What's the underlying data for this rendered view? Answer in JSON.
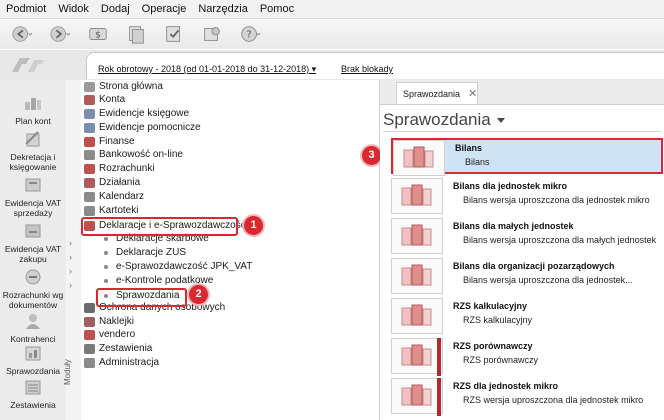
{
  "menu": [
    "Podmiot",
    "Widok",
    "Dodaj",
    "Operacje",
    "Narzędzia",
    "Pomoc"
  ],
  "toolbar_icons": [
    "back-icon",
    "forward-icon",
    "money-icon",
    "documents-icon",
    "check-doc-icon",
    "stamp-icon",
    "help-icon"
  ],
  "header": {
    "year_label": "Rok obrotowy - 2018  (od 01-01-2018 do 31-12-2018)",
    "locks_label": "Brak blokady"
  },
  "leftnav": [
    {
      "label": "Plan kont",
      "icon": "chart-of-accounts-icon"
    },
    {
      "label": "Dekretacja i księgowanie",
      "icon": "posting-icon"
    },
    {
      "label": "Ewidencja VAT sprzedaży",
      "icon": "vat-sales-icon"
    },
    {
      "label": "Ewidencja VAT zakupu",
      "icon": "vat-purchase-icon"
    },
    {
      "label": "Rozrachunki wg dokumentów",
      "icon": "settlements-icon"
    },
    {
      "label": "Kontrahenci",
      "icon": "contractors-icon"
    },
    {
      "label": "Sprawozdania",
      "icon": "reports-icon"
    },
    {
      "label": "Zestawienia",
      "icon": "statements-icon"
    }
  ],
  "vertical_label": "Moduły",
  "tree": [
    {
      "label": "Strona główna",
      "type": "icon"
    },
    {
      "label": "Konta",
      "type": "icon"
    },
    {
      "label": "Ewidencje księgowe",
      "type": "icon"
    },
    {
      "label": "Ewidencje pomocnicze",
      "type": "icon"
    },
    {
      "label": "Finanse",
      "type": "icon"
    },
    {
      "label": "Bankowość on-line",
      "type": "icon"
    },
    {
      "label": "Rozrachunki",
      "type": "icon"
    },
    {
      "label": "Działania",
      "type": "icon"
    },
    {
      "label": "Kalendarz",
      "type": "icon"
    },
    {
      "label": "Kartoteki",
      "type": "icon"
    },
    {
      "label": "Deklaracje i e-Sprawozdawczość",
      "type": "icon"
    },
    {
      "label": "Deklaracje skarbowe",
      "type": "bullet"
    },
    {
      "label": "Deklaracje ZUS",
      "type": "bullet"
    },
    {
      "label": "e-Sprawozdawczość JPK_VAT",
      "type": "bullet"
    },
    {
      "label": "e-Kontrole podatkowe",
      "type": "bullet"
    },
    {
      "label": "Sprawozdania",
      "type": "bullet"
    },
    {
      "label": "Ochrona danych osobowych",
      "type": "icon"
    },
    {
      "label": "Naklejki",
      "type": "icon"
    },
    {
      "label": "vendero",
      "type": "icon"
    },
    {
      "label": "Zestawienia",
      "type": "icon"
    },
    {
      "label": "Administracja",
      "type": "icon"
    }
  ],
  "callouts": [
    "1",
    "2",
    "3"
  ],
  "tab": {
    "label": "Sprawozdania",
    "close": "✕"
  },
  "heading": "Sprawozdania",
  "cards": [
    {
      "title": "Bilans",
      "subtitle": "Bilans"
    },
    {
      "title": "Bilans dla jednostek mikro",
      "subtitle": "Bilans wersja uproszczona dla jednostek mikro"
    },
    {
      "title": "Bilans dla małych jednostek",
      "subtitle": "Bilans wersja uproszczona dla małych jednostek"
    },
    {
      "title": "Bilans dla organizacji pozarządowych",
      "subtitle": "Bilans wersja uproszczona dla jednostek..."
    },
    {
      "title": "RZS kalkulacyjny",
      "subtitle": "RZS kalkulacyjny"
    },
    {
      "title": "RZS porównawczy",
      "subtitle": "RZS porównawczy"
    },
    {
      "title": "RZS dla jednostek mikro",
      "subtitle": "RZS wersja uproszczona dla jednostek mikro"
    }
  ],
  "colors": {
    "accent_red": "#d9282f",
    "selection": "#cfe3f6"
  }
}
